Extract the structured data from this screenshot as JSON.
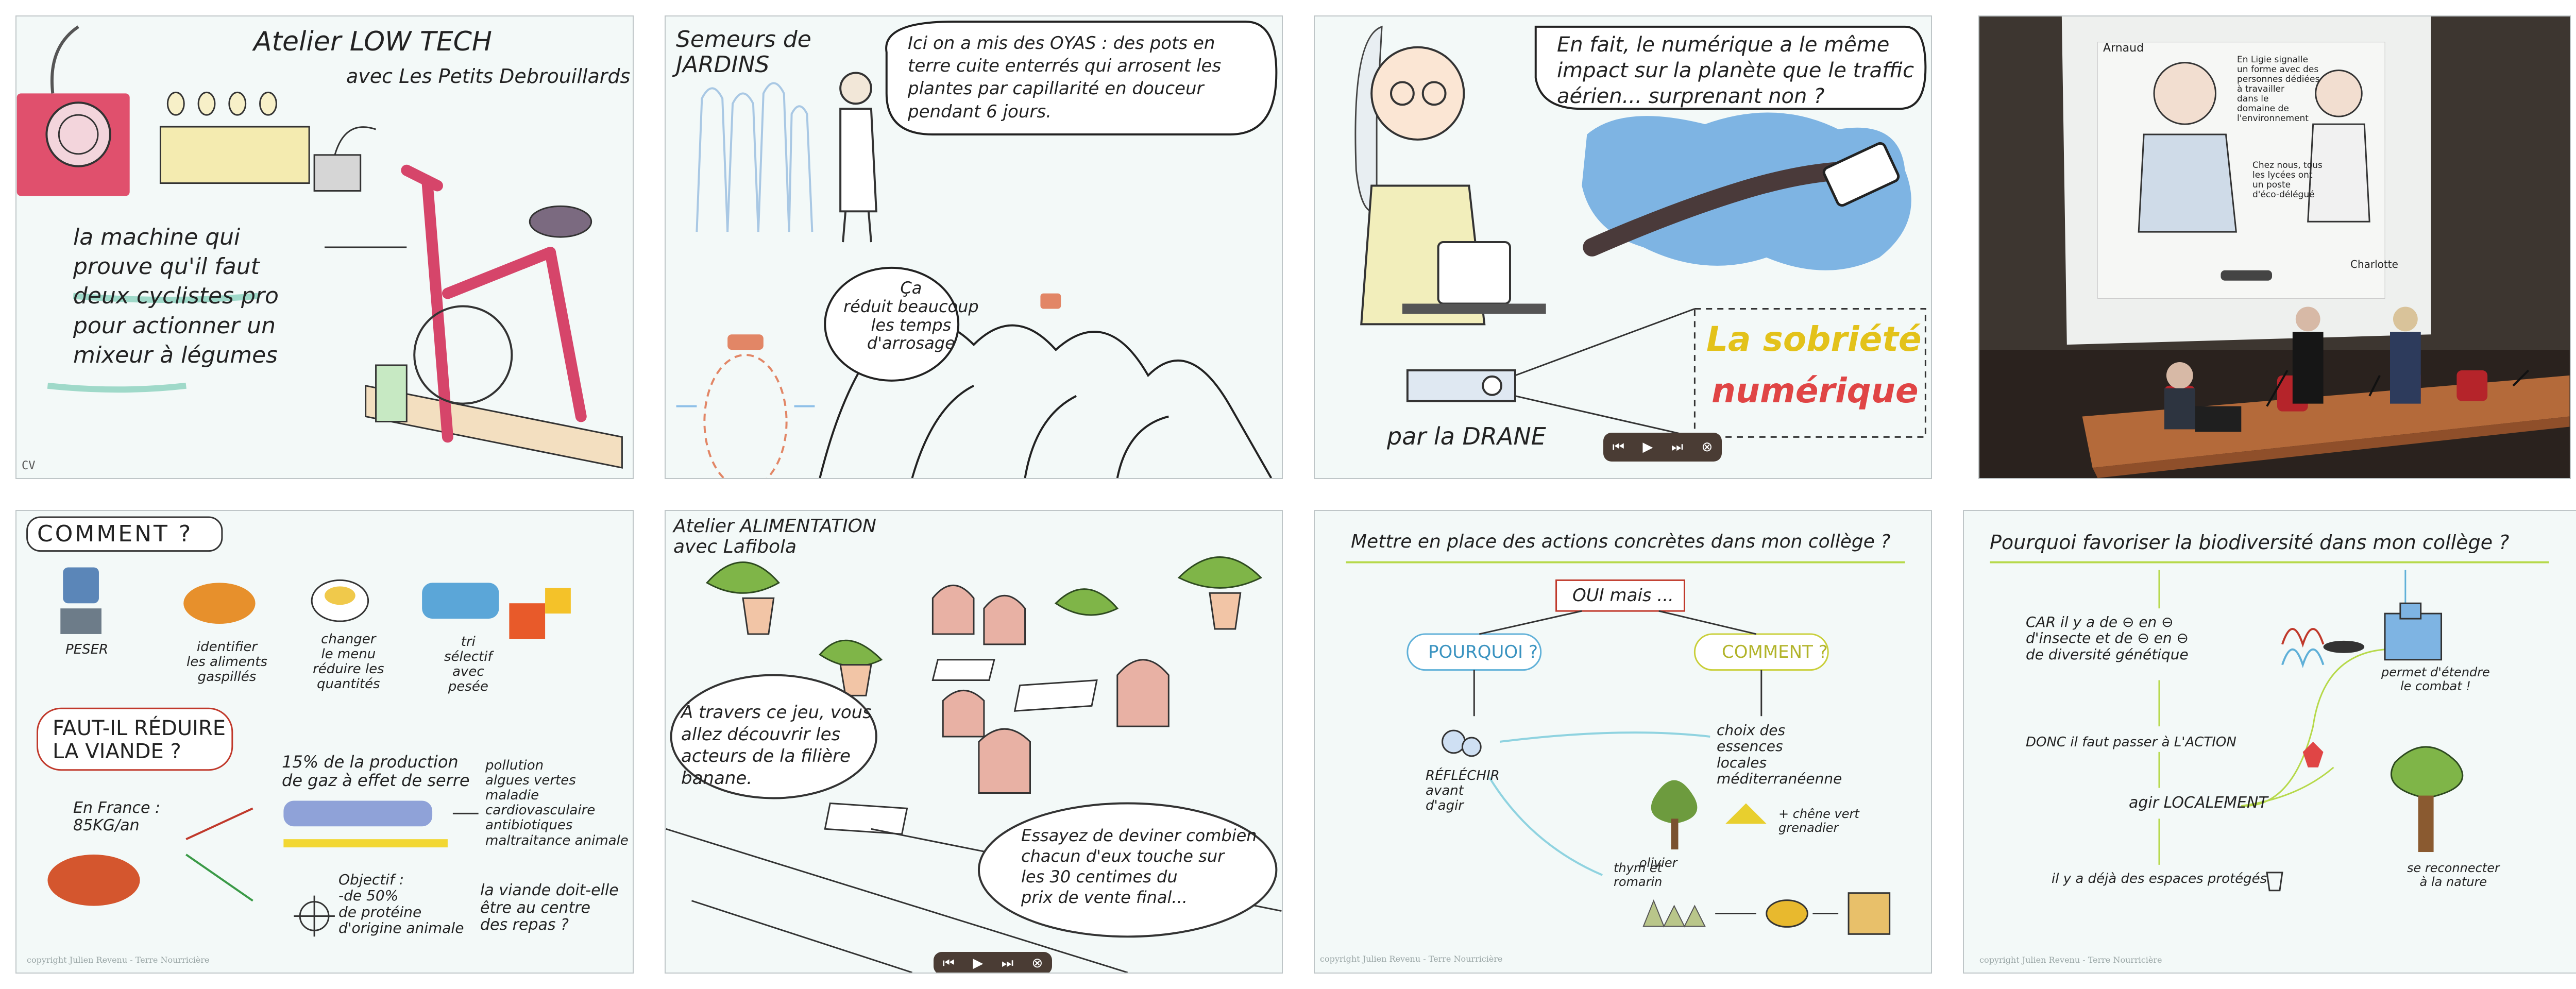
{
  "panels": {
    "lowtech": {
      "title": "Atelier LOW TECH",
      "subtitle": "avec Les Petits Debrouillards",
      "caption": "la machine qui\nprouve qu'il faut\ndeux cyclistes pro\npour actionner un\nmixeur à légumes",
      "corner_mark": "CV"
    },
    "semeurs": {
      "title": "Semeurs de\nJARDINS",
      "bubble_top": "Ici on a mis des OYAS : des pots en\nterre cuite enterrés qui arrosent les\nplantes par capillarité en douceur\npendant 6 jours.",
      "bubble_small": "Ça\nréduit beaucoup\nles temps\nd'arrosage"
    },
    "drane": {
      "bubble": "En fait, le numérique a le même\nimpact sur la planète que le traffic\naérien... surprenant non ?",
      "highlight_line1": "La sobriété",
      "highlight_line2": "numérique",
      "byline": "par la DRANE"
    },
    "photo": {
      "screen_left_name": "Arnaud",
      "screen_right_name": "Charlotte",
      "screen_bubble_1": "En Ligie signalle\nun forme avec des\npersonnes dédiées\nà travailler\ndans le\ndomaine de\nl'environnement",
      "screen_bubble_2": "Chez nous, tous\nles lycées ont\nun poste\nd'éco-délégué"
    },
    "comment": {
      "title": "COMMENT ?",
      "item1": "PESER",
      "item2": "identifier\nles aliments\ngaspillés",
      "item3": "changer\nle menu\nréduire les\nquantités",
      "item4": "tri\nsélectif\navec\npesée",
      "question": "FAUT-IL RÉDUIRE\nLA VIANDE ?",
      "france": "En France :\n85KG/an",
      "stat": "15% de la production\nde gaz à effet de serre",
      "effects": "pollution\nalgues vertes\nmaladie cardiovasculaire\nantibiotiques\nmaltraitance animale",
      "objective": "Objectif :\n-de 50%\nde protéine\nd'origine animale",
      "center": "la viande doit-elle\nêtre au centre\ndes repas ?",
      "copyright": "copyright Julien Revenu - Terre Nourricière"
    },
    "alimentation": {
      "title": "Atelier ALIMENTATION\navec Lafibola",
      "bubble_left": "À travers ce jeu, vous\nallez découvrir les\nacteurs de la filière\nbanane.",
      "bubble_right": "Essayez de deviner combien\nchacun d'eux touche sur\nles 30 centimes du\nprix de vente final..."
    },
    "actions": {
      "title": "Mettre en place des actions concrètes dans mon collège ?",
      "oui": "OUI mais ...",
      "pourquoi": "POURQUOI ?",
      "comment": "COMMENT ?",
      "reflechir": "RÉFLÉCHIR\navant\nd'agir",
      "essences": "choix des\nessences\nlocales\nméditerranéenne",
      "olivier": "olivier",
      "chene": "+ chêne vert\ngrenadier",
      "thym": "thym et\nromarin",
      "copyright": "copyright Julien Revenu - Terre Nourricière"
    },
    "biodiversite": {
      "title": "Pourquoi favoriser la biodiversité dans mon collège ?",
      "car": "CAR il y a de ⊖ en ⊖\nd'insecte et de ⊖ en ⊖\nde diversité génétique",
      "donc": "DONC il faut passer à L'ACTION",
      "agir": "agir LOCALEMENT",
      "espaces": "il y a déjà des espaces protégés",
      "combat": "permet d'étendre\nle combat !",
      "nature": "se reconnecter\nà la nature",
      "copyright": "copyright Julien Revenu - Terre Nourricière"
    }
  },
  "colors": {
    "panel_bg": "#f3f9f8",
    "bike_red": "#d6456a",
    "teal": "#5fc6b5",
    "yellow": "#f0d233",
    "control_bg": "#4a3c34",
    "photo_wall": "#3d3630",
    "desk_wood": "#b46a3a"
  },
  "icons": [
    "play-icon",
    "rewind-icon",
    "forward-icon",
    "close-icon"
  ]
}
